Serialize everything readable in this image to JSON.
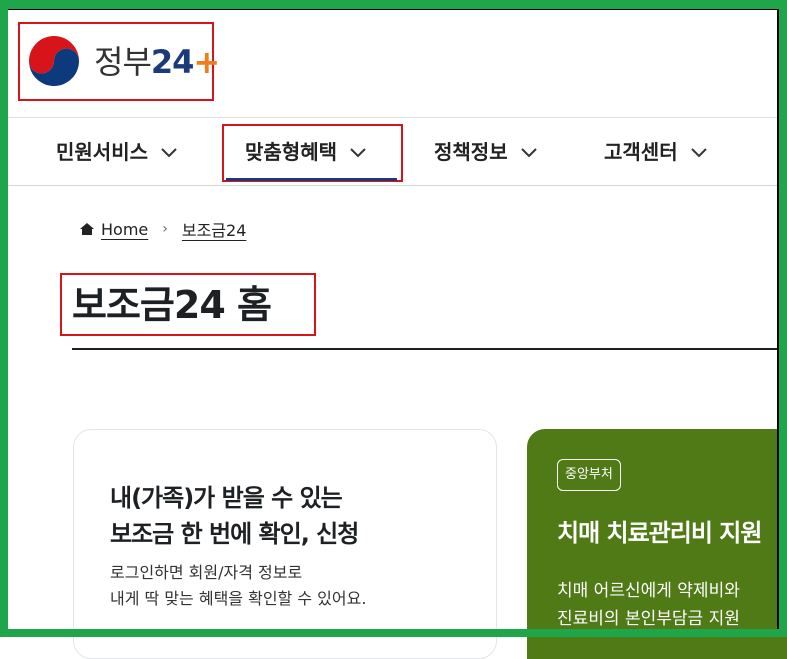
{
  "header": {
    "logo_text_main": "정부",
    "logo_text_num": "24",
    "logo_plus": "+"
  },
  "nav": {
    "items": [
      {
        "label": "민원서비스"
      },
      {
        "label": "맞춤형혜택"
      },
      {
        "label": "정책정보"
      },
      {
        "label": "고객센터"
      }
    ],
    "active_index": 1
  },
  "breadcrumb": {
    "home": "Home",
    "current": "보조금24",
    "separator": "›"
  },
  "page": {
    "title": "보조금24 홈"
  },
  "card_login": {
    "headline_line1": "내(가족)가 받을 수 있는",
    "headline_line2": "보조금 한 번에 확인, 신청",
    "desc_line1": "로그인하면 회원/자격 정보로",
    "desc_line2": "내게 딱 맞는 혜택을 확인할 수 있어요."
  },
  "card_promo": {
    "badge": "중앙부처",
    "title": "치매 치료관리비 지원",
    "desc_line1": "치매 어르신에게 약제비와",
    "desc_line2": "진료비의 본인부담금 지원"
  },
  "colors": {
    "frame": "#1fa64a",
    "highlight": "#d7141a",
    "brand_navy": "#1a3a7a",
    "promo_green": "#4f7a16"
  }
}
